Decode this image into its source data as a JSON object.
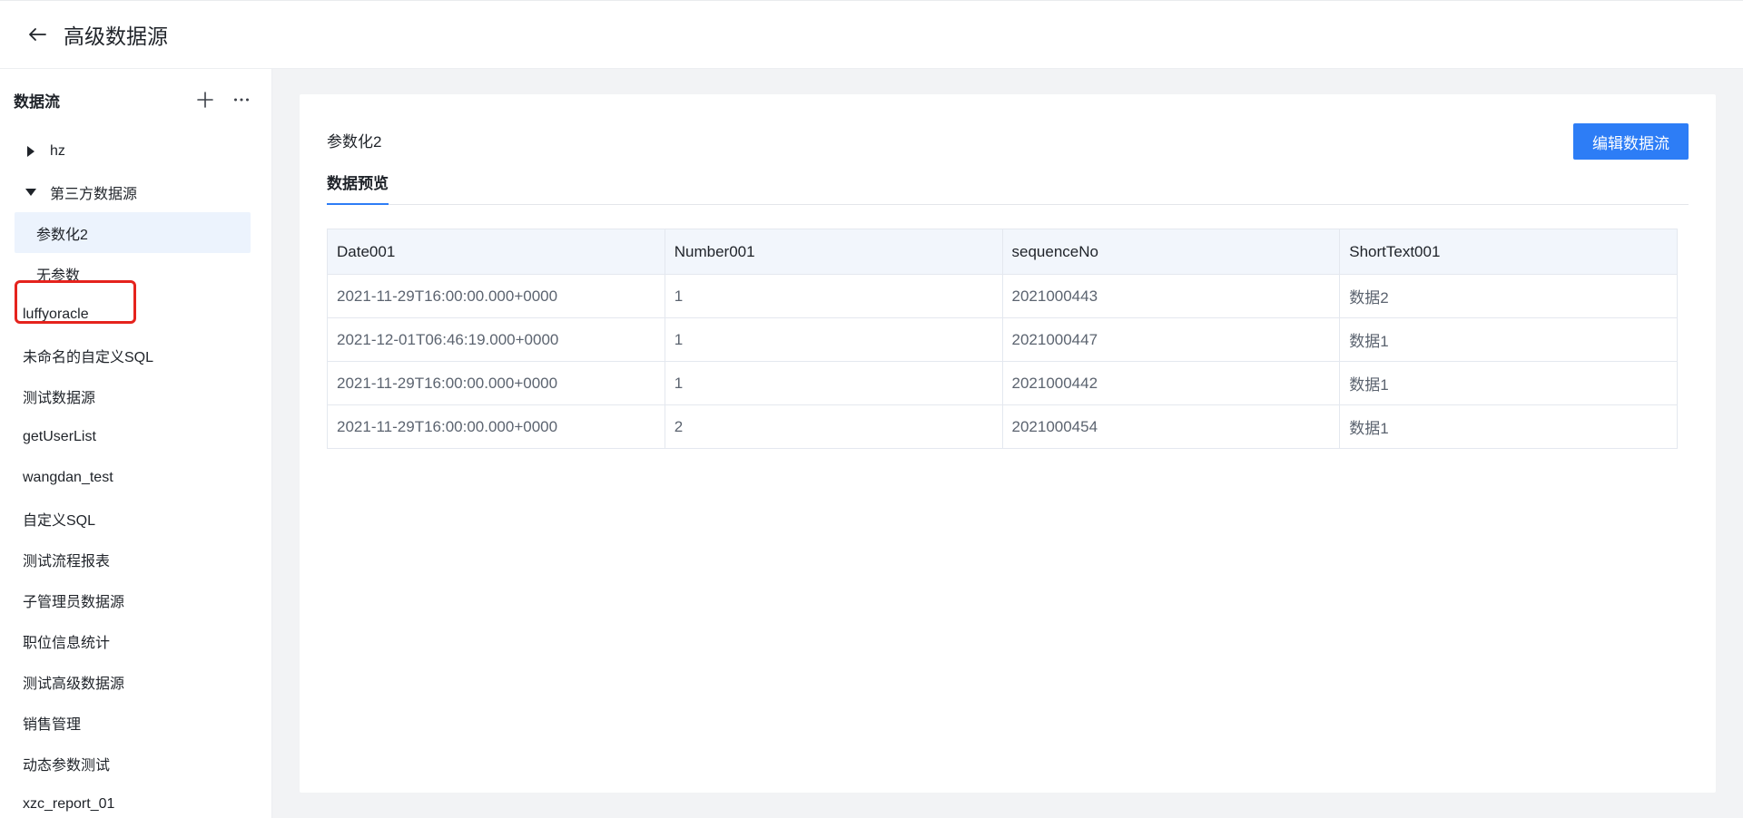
{
  "header": {
    "title": "高级数据源"
  },
  "sidebar": {
    "title": "数据流",
    "folders": [
      {
        "label": "hz",
        "expanded": false
      },
      {
        "label": "第三方数据源",
        "expanded": true,
        "children": [
          "参数化2",
          "无参数"
        ]
      }
    ],
    "items": [
      "luffyoracle",
      "未命名的自定义SQL",
      "测试数据源",
      "getUserList",
      "wangdan_test",
      "自定义SQL",
      "测试流程报表",
      "子管理员数据源",
      "职位信息统计",
      "测试高级数据源",
      "销售管理",
      "动态参数测试",
      "xzc_report_01"
    ],
    "selected": "参数化2"
  },
  "main": {
    "title": "参数化2",
    "edit_button": "编辑数据流",
    "tab": "数据预览",
    "table": {
      "columns": [
        "Date001",
        "Number001",
        "sequenceNo",
        "ShortText001"
      ],
      "rows": [
        [
          "2021-11-29T16:00:00.000+0000",
          "1",
          "2021000443",
          "数据2"
        ],
        [
          "2021-12-01T06:46:19.000+0000",
          "1",
          "2021000447",
          "数据1"
        ],
        [
          "2021-11-29T16:00:00.000+0000",
          "1",
          "2021000442",
          "数据1"
        ],
        [
          "2021-11-29T16:00:00.000+0000",
          "2",
          "2021000454",
          "数据1"
        ]
      ]
    }
  },
  "colors": {
    "accent": "#2d7df6",
    "highlight": "#e5231d",
    "selected_bg": "#ecf3fd",
    "main_bg": "#f2f3f5"
  }
}
